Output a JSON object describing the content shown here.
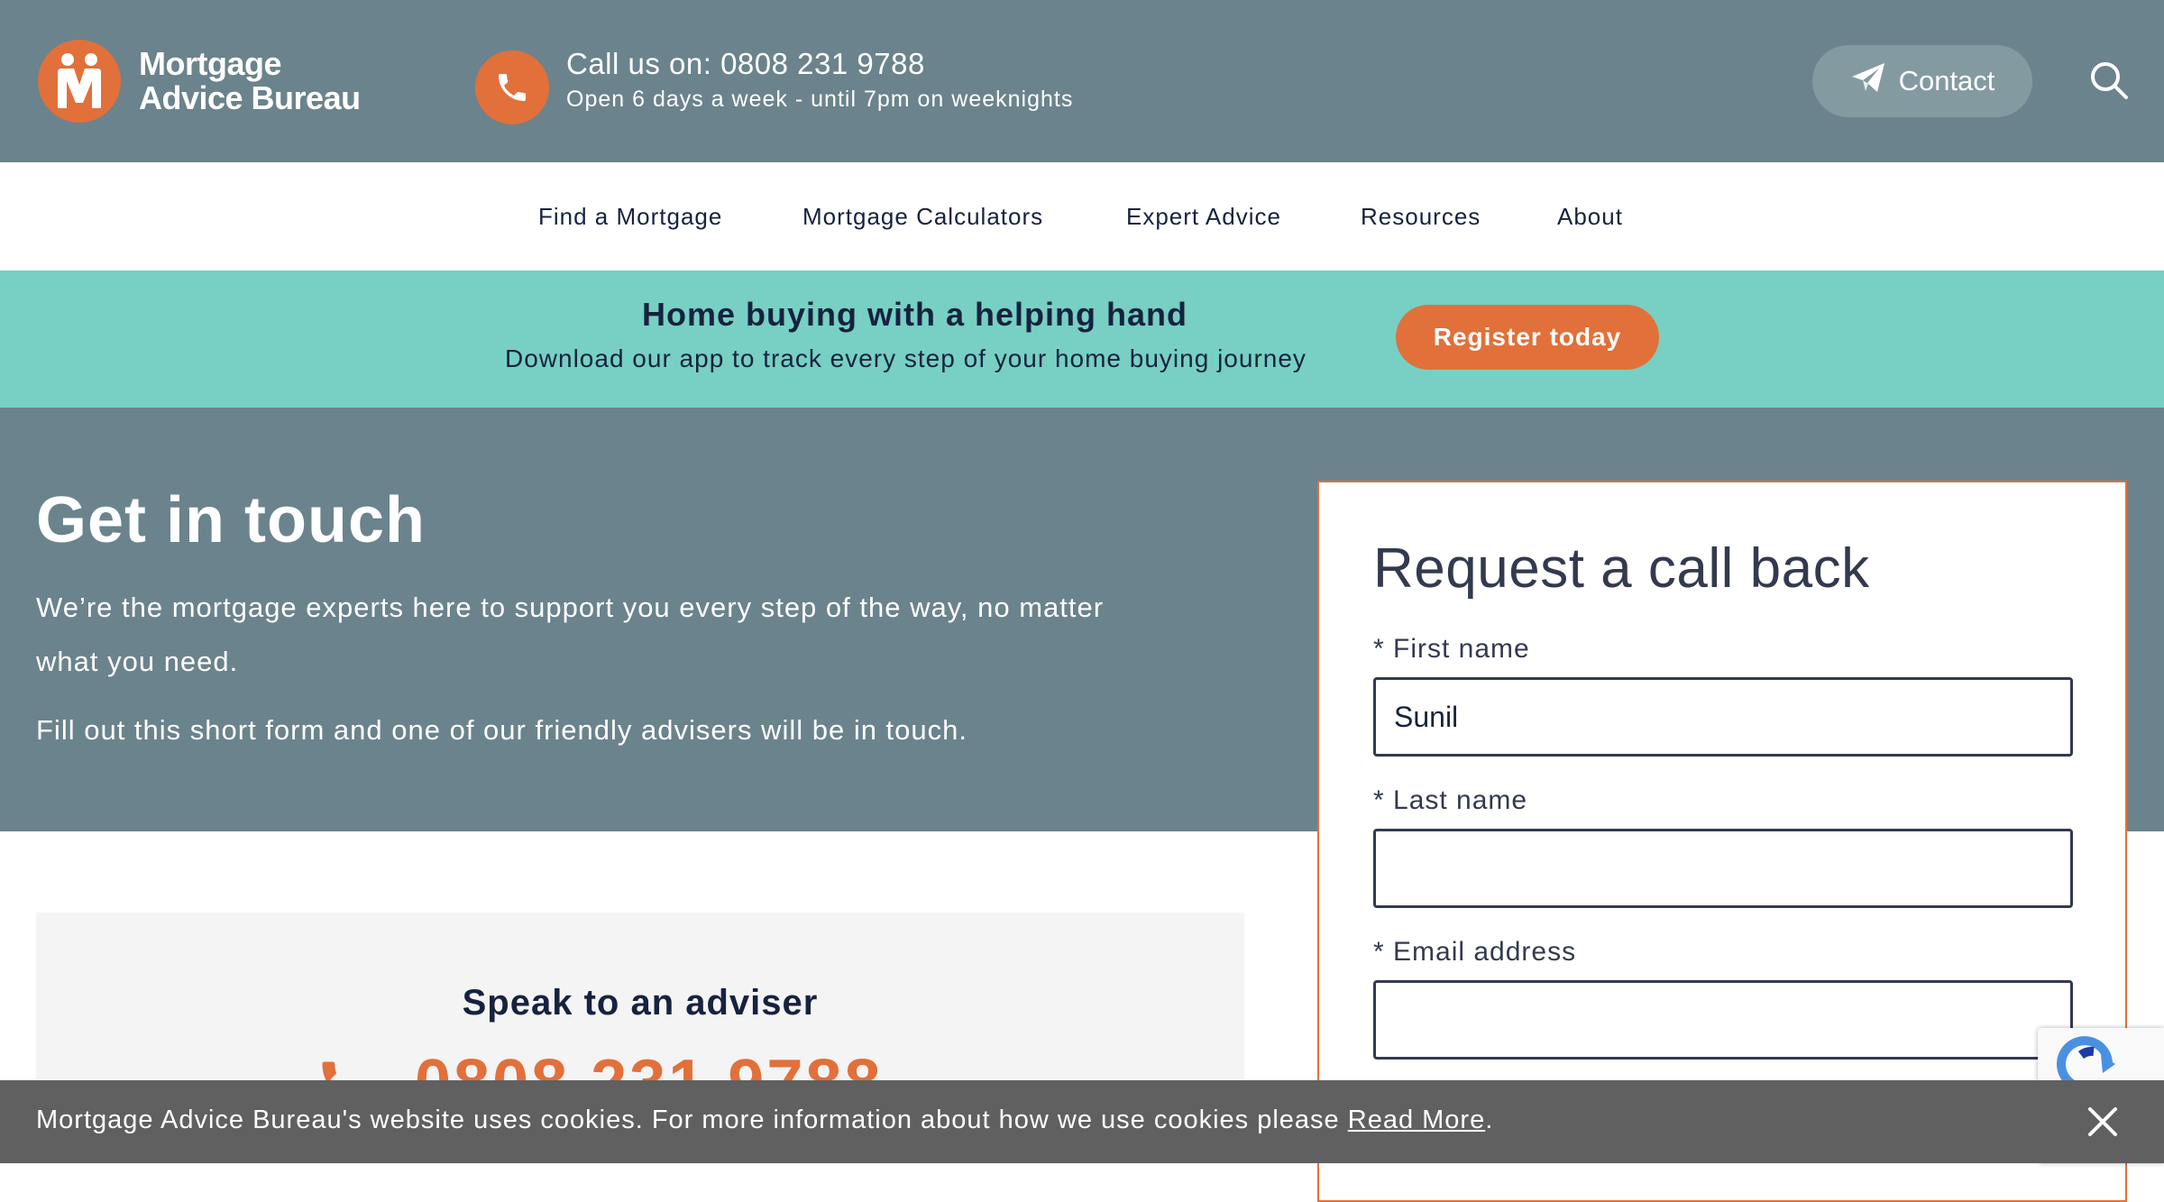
{
  "brand": {
    "line1": "Mortgage",
    "line2": "Advice Bureau",
    "accent": "#e2703a",
    "header_bg": "#6b838c",
    "teal": "#77d0c3",
    "navy": "#16223f"
  },
  "header": {
    "call_label": "Call us on: 0808 231 9788",
    "hours": "Open 6 days a week - until 7pm on weeknights",
    "contact_label": "Contact",
    "icons": [
      "phone-icon",
      "paper-plane-icon",
      "search-icon"
    ]
  },
  "nav": {
    "items": [
      {
        "label": "Find a Mortgage"
      },
      {
        "label": "Mortgage Calculators"
      },
      {
        "label": "Expert Advice"
      },
      {
        "label": "Resources"
      },
      {
        "label": "About"
      }
    ]
  },
  "promo": {
    "title": "Home buying with a helping hand",
    "subtitle": "Download our app to track every step of your home buying journey",
    "cta": "Register today"
  },
  "hero": {
    "title": "Get in touch",
    "para1": "We’re the mortgage experts here to support you every step of the way, no matter what you need.",
    "para2": "Fill out this short form and one of our friendly advisers will be in touch."
  },
  "speak": {
    "title": "Speak to an adviser",
    "number": "0808 231 9788"
  },
  "form": {
    "title": "Request a call back",
    "first_name_label": "* First name",
    "first_name_value": "Sunil",
    "last_name_label": "* Last name",
    "last_name_value": "",
    "email_label": "* Email address",
    "email_value": ""
  },
  "cookie": {
    "text": "Mortgage Advice Bureau's website uses cookies. For more information about how we use cookies please ",
    "link": "Read More",
    "suffix": "."
  }
}
